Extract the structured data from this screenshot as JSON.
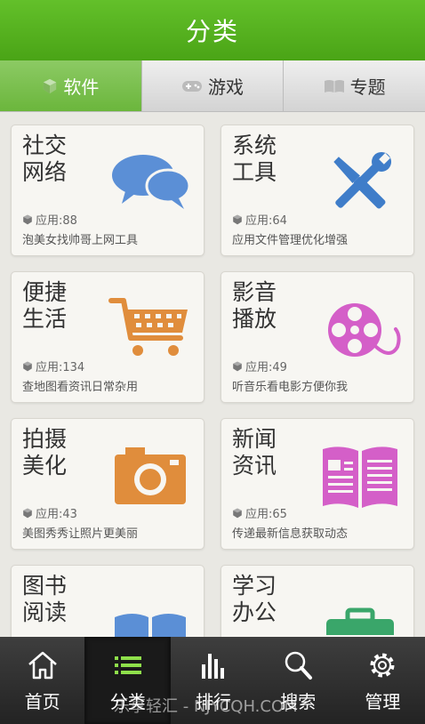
{
  "header": {
    "title": "分类"
  },
  "tabs": [
    {
      "label": "软件",
      "icon": "cube-icon",
      "active": true
    },
    {
      "label": "游戏",
      "icon": "gamepad-icon",
      "active": false
    },
    {
      "label": "专题",
      "icon": "book-icon",
      "active": false
    }
  ],
  "categories": [
    {
      "title": "社交\n网络",
      "count": "应用:88",
      "desc": "泡美女找帅哥上网工具",
      "icon": "chat-bubbles-icon",
      "color": "#5b8fd6"
    },
    {
      "title": "系统\n工具",
      "count": "应用:64",
      "desc": "应用文件管理优化增强",
      "icon": "tools-icon",
      "color": "#3f7dc9"
    },
    {
      "title": "便捷\n生活",
      "count": "应用:134",
      "desc": "查地图看资讯日常杂用",
      "icon": "shopping-cart-icon",
      "color": "#e08d3c"
    },
    {
      "title": "影音\n播放",
      "count": "应用:49",
      "desc": "听音乐看电影方便你我",
      "icon": "film-reel-icon",
      "color": "#d45fc8"
    },
    {
      "title": "拍摄\n美化",
      "count": "应用:43",
      "desc": "美图秀秀让照片更美丽",
      "icon": "camera-icon",
      "color": "#e08d3c"
    },
    {
      "title": "新闻\n资讯",
      "count": "应用:65",
      "desc": "传递最新信息获取动态",
      "icon": "newspaper-icon",
      "color": "#d45fc8"
    },
    {
      "title": "图书\n阅读",
      "count": "",
      "desc": "",
      "icon": "open-book-icon",
      "color": "#5b8fd6"
    },
    {
      "title": "学习\n办公",
      "count": "",
      "desc": "",
      "icon": "briefcase-icon",
      "color": "#3aa66a"
    }
  ],
  "bottom_nav": [
    {
      "label": "首页",
      "icon": "home-icon",
      "active": false
    },
    {
      "label": "分类",
      "icon": "list-icon",
      "active": true
    },
    {
      "label": "排行",
      "icon": "bar-chart-icon",
      "active": false
    },
    {
      "label": "搜索",
      "icon": "search-icon",
      "active": false
    },
    {
      "label": "管理",
      "icon": "gear-icon",
      "active": false
    }
  ],
  "watermark": "乐享轻汇 - NJYCQH.COM"
}
